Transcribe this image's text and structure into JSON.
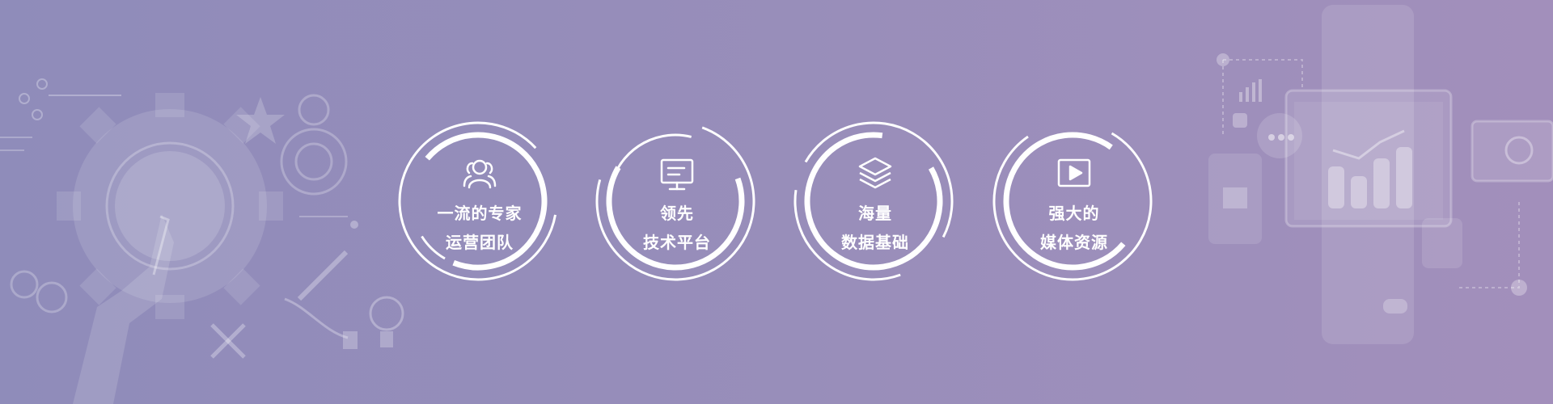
{
  "banner": {
    "background_colors": [
      "#8f8cba",
      "#a28fbb"
    ],
    "accent_color": "#ffffff"
  },
  "features": [
    {
      "icon": "team-icon",
      "line1": "一流的专家",
      "line2": "运营团队"
    },
    {
      "icon": "monitor-icon",
      "line1": "领先",
      "line2": "技术平台"
    },
    {
      "icon": "layers-icon",
      "line1": "海量",
      "line2": "数据基础"
    },
    {
      "icon": "play-icon",
      "line1": "强大的",
      "line2": "媒体资源"
    }
  ]
}
